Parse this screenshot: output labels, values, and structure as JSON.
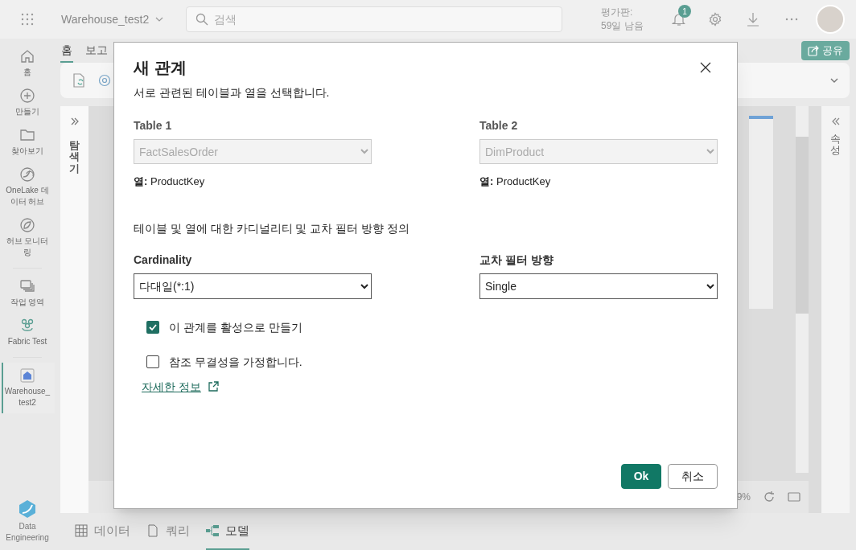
{
  "top_bar": {
    "app_name": "Warehouse_test2",
    "search": {
      "placeholder": "검색"
    },
    "trial_lines": [
      "평가판:",
      "59일 남음"
    ],
    "notification_count": "1"
  },
  "nav_rail": [
    {
      "label": "홈",
      "selected": false
    },
    {
      "label": "만들기",
      "selected": false
    },
    {
      "label": "찾아보기",
      "selected": false
    },
    {
      "label": "OneLake 데이터 허브",
      "selected": false
    },
    {
      "label": "허브 모니터링",
      "selected": false
    },
    {
      "label": "작업 영역",
      "selected": false
    },
    {
      "label": "Fabric Test",
      "selected": false
    },
    {
      "label": "Warehouse_ test2",
      "selected": true
    }
  ],
  "nav_footer": {
    "label": "Data Engineering"
  },
  "ribbon_tabs": [
    {
      "label": "홈",
      "selected": true
    },
    {
      "label": "보고",
      "selected": false
    }
  ],
  "share_button": "공유",
  "explorer_panel": {
    "title": "탐색기"
  },
  "properties_panel": {
    "title": "속성"
  },
  "zoom_reading": "9%",
  "bottom_tabs": [
    {
      "label": "데이터",
      "selected": false
    },
    {
      "label": "쿼리",
      "selected": false
    },
    {
      "label": "모델",
      "selected": true
    }
  ],
  "dialog": {
    "title": "새 관계",
    "subtitle": "서로 관련된 테이블과 열을 선택합니다.",
    "tables": [
      {
        "label": "Table 1",
        "value": "FactSalesOrder",
        "disabled": true,
        "column": "**열:** ProductKey"
      },
      {
        "label": "Table 2",
        "value": "DimProduct",
        "disabled": true,
        "column": "**열:** ProductKey"
      }
    ],
    "description": "테이블 및 열에 대한 카디널리티 및 교차 필터 방향 정의",
    "dropdowns": [
      {
        "label": "Cardinality",
        "value": "다대일(*:1)"
      },
      {
        "label": "교차 필터 방향",
        "value": "Single"
      }
    ],
    "checkboxes": [
      {
        "label": "이 관계를 활성으로 만들기",
        "checked": true
      },
      {
        "label": "참조 무결성을 가정합니다.",
        "checked": false
      }
    ],
    "link": "자세한 정보",
    "buttons": [
      {
        "label": "Ok",
        "kind": "primary"
      },
      {
        "label": "취소",
        "kind": "secondary"
      }
    ]
  }
}
